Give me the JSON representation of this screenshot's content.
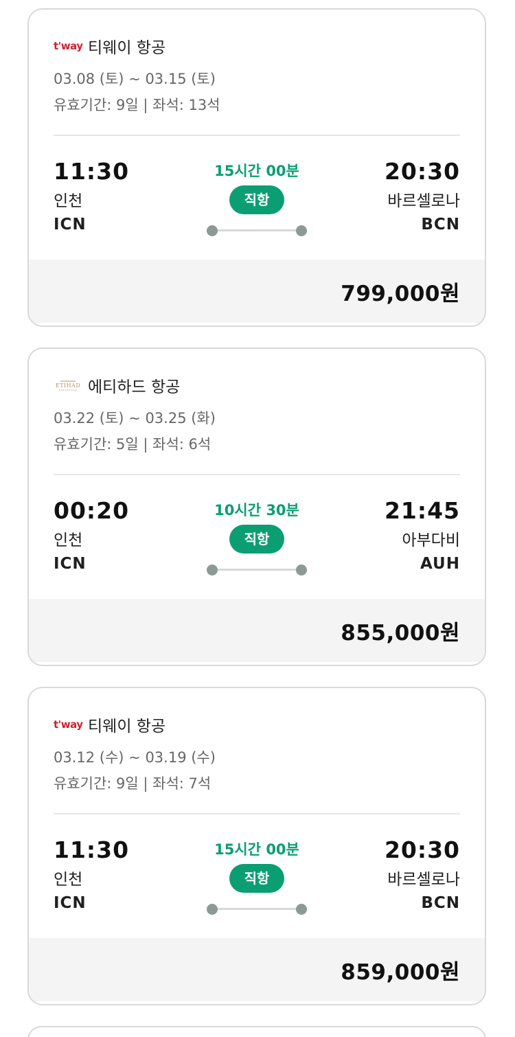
{
  "flights": [
    {
      "airline_logo": "tway-logo",
      "airline_logo_text": "t'way",
      "airline_name": "티웨이 항공",
      "dates": "03.08 (토) ~ 03.15 (토)",
      "meta": "유효기간: 9일 | 좌석: 13석",
      "dep_time": "11:30",
      "dep_city": "인천",
      "dep_code": "ICN",
      "duration": "15시간 00분",
      "badge": "직항",
      "arr_time": "20:30",
      "arr_city": "바르셀로나",
      "arr_code": "BCN",
      "price": "799,000원"
    },
    {
      "airline_logo": "etihad-logo",
      "airline_logo_text": "ETIHAD",
      "airline_name": "에티하드 항공",
      "dates": "03.22 (토) ~ 03.25 (화)",
      "meta": "유효기간: 5일 | 좌석: 6석",
      "dep_time": "00:20",
      "dep_city": "인천",
      "dep_code": "ICN",
      "duration": "10시간 30분",
      "badge": "직항",
      "arr_time": "21:45",
      "arr_city": "아부다비",
      "arr_code": "AUH",
      "price": "855,000원"
    },
    {
      "airline_logo": "tway-logo",
      "airline_logo_text": "t'way",
      "airline_name": "티웨이 항공",
      "dates": "03.12 (수) ~ 03.19 (수)",
      "meta": "유효기간: 9일 | 좌석: 7석",
      "dep_time": "11:30",
      "dep_city": "인천",
      "dep_code": "ICN",
      "duration": "15시간 00분",
      "badge": "직항",
      "arr_time": "20:30",
      "arr_city": "바르셀로나",
      "arr_code": "BCN",
      "price": "859,000원"
    }
  ],
  "colors": {
    "accent": "#0b9e73",
    "tway_red": "#d0202f",
    "etihad_gold": "#b8955a"
  }
}
